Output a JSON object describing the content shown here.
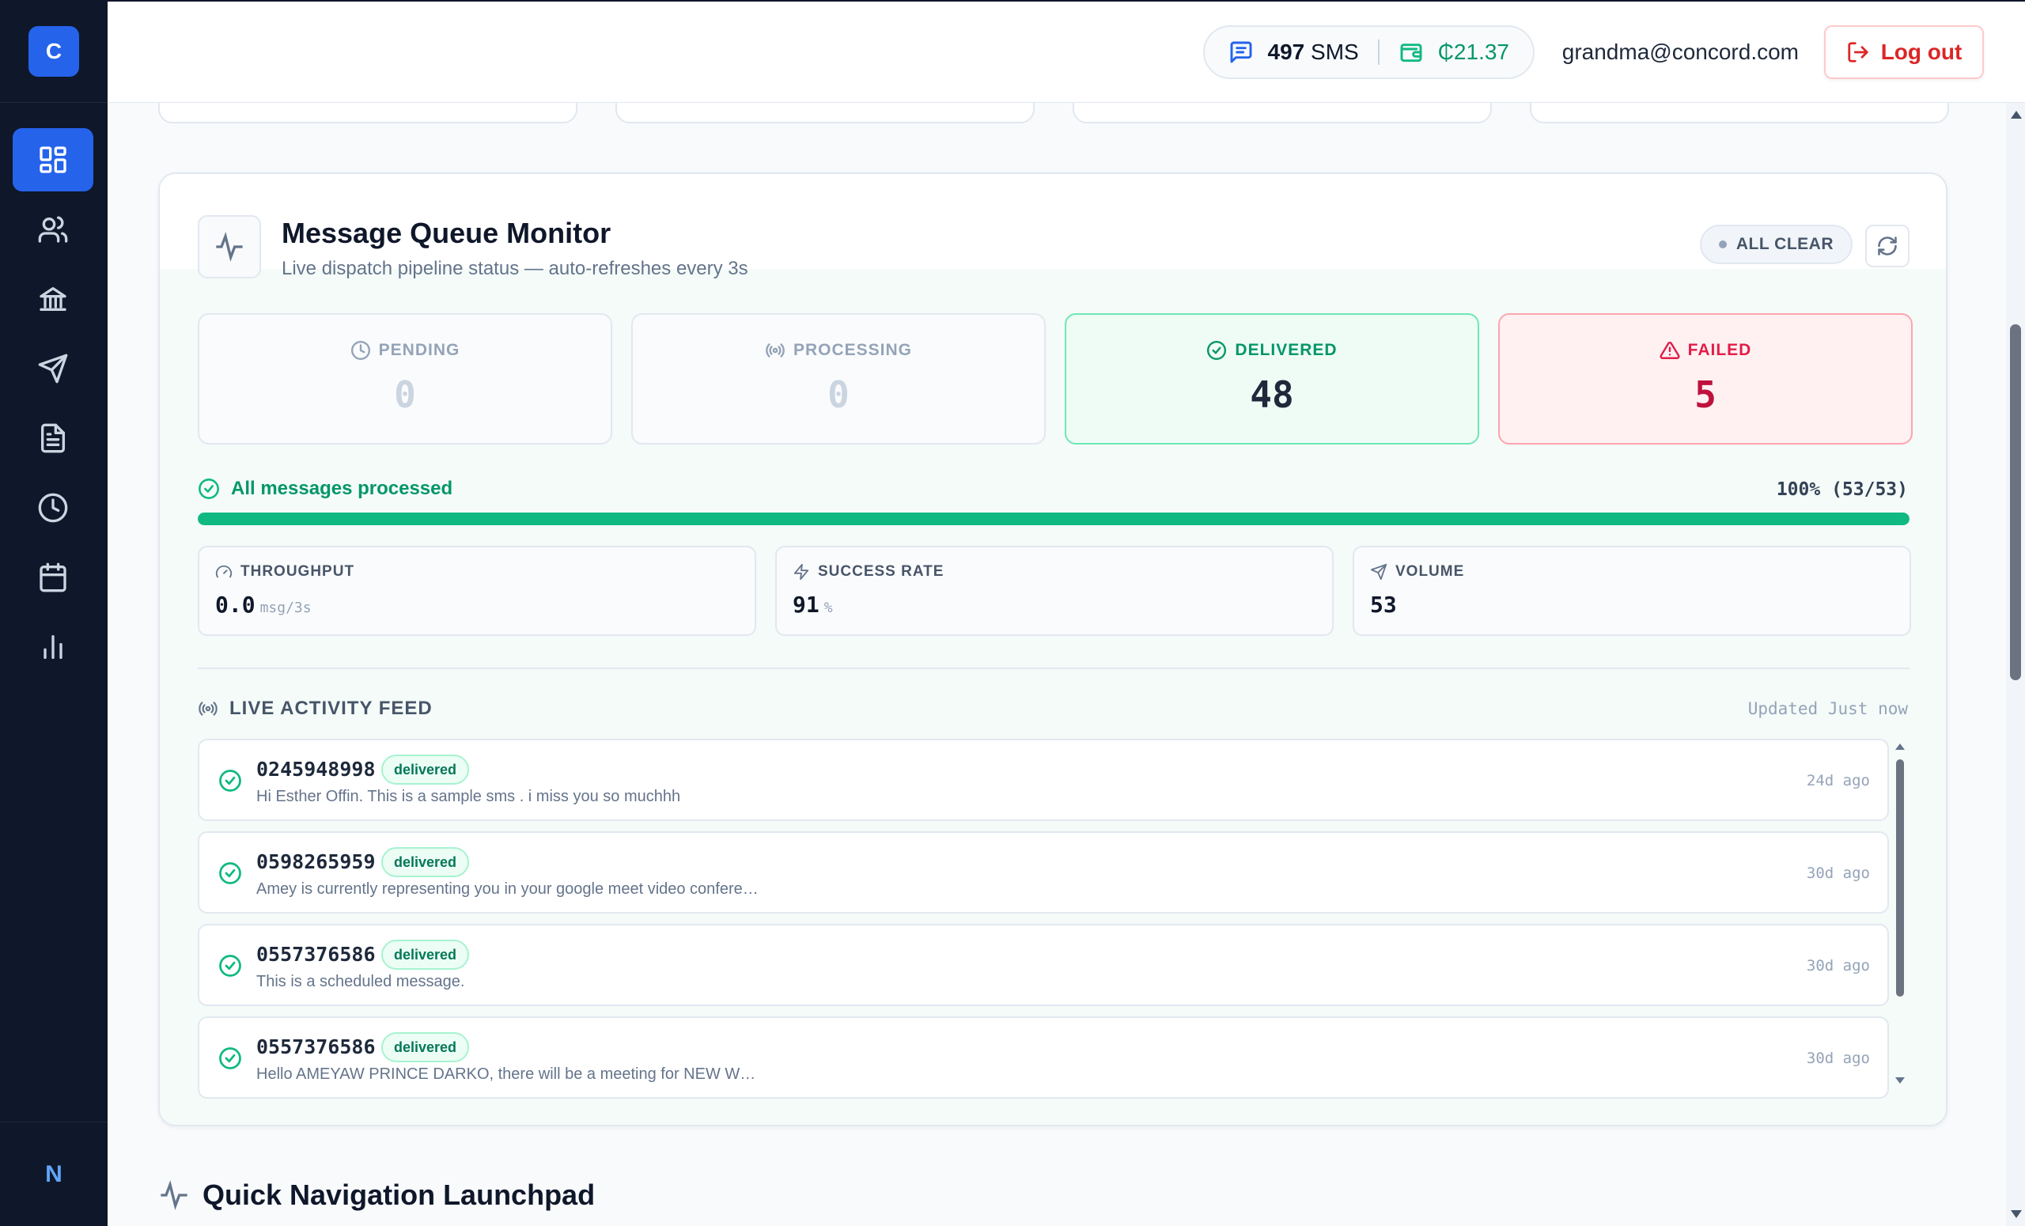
{
  "sidebar": {
    "logo_letter": "C",
    "items": [
      {
        "icon": "dashboard-icon",
        "active": true
      },
      {
        "icon": "users-icon",
        "active": false
      },
      {
        "icon": "bank-icon",
        "active": false
      },
      {
        "icon": "send-icon",
        "active": false
      },
      {
        "icon": "document-icon",
        "active": false
      },
      {
        "icon": "clock-icon",
        "active": false
      },
      {
        "icon": "calendar-icon",
        "active": false
      },
      {
        "icon": "bar-chart-icon",
        "active": false
      }
    ],
    "avatar_letter": "N"
  },
  "header": {
    "sms_count": "497",
    "sms_label": "SMS",
    "balance": "₵21.37",
    "user_email": "grandma@concord.com",
    "logout_label": "Log out"
  },
  "monitor": {
    "title": "Message Queue Monitor",
    "subtitle": "Live dispatch pipeline status — auto-refreshes every 3s",
    "status_badge": "ALL CLEAR",
    "stats": [
      {
        "label": "PENDING",
        "value": "0",
        "icon": "clock-icon"
      },
      {
        "label": "PROCESSING",
        "value": "0",
        "icon": "broadcast-icon"
      },
      {
        "label": "DELIVERED",
        "value": "48",
        "icon": "check-circle-icon"
      },
      {
        "label": "FAILED",
        "value": "5",
        "icon": "alert-triangle-icon"
      }
    ],
    "progress_label": "All messages processed",
    "progress_text": "100% (53/53)",
    "progress_fraction": 1.0,
    "metrics": [
      {
        "label": "THROUGHPUT",
        "value": "0.0",
        "unit": "msg/3s",
        "icon": "gauge-icon"
      },
      {
        "label": "SUCCESS RATE",
        "value": "91",
        "unit": "%",
        "icon": "zap-icon"
      },
      {
        "label": "VOLUME",
        "value": "53",
        "unit": "",
        "icon": "send-icon"
      }
    ],
    "feed_title": "LIVE ACTIVITY FEED",
    "feed_updated": "Updated Just now",
    "feed": [
      {
        "phone": "0245948998",
        "status": "delivered",
        "message": "Hi Esther Offin. This is a sample sms . i miss you so muchhh",
        "time": "24d ago"
      },
      {
        "phone": "0598265959",
        "status": "delivered",
        "message": "Amey is currently representing you in your google meet video confere…",
        "time": "30d ago"
      },
      {
        "phone": "0557376586",
        "status": "delivered",
        "message": "This is a scheduled message.",
        "time": "30d ago"
      },
      {
        "phone": "0557376586",
        "status": "delivered",
        "message": "Hello AMEYAW PRINCE DARKO, there will be a meeting for NEW W…",
        "time": "30d ago"
      }
    ]
  },
  "quick_nav": {
    "title": "Quick Navigation Launchpad"
  },
  "colors": {
    "accent": "#2563eb",
    "success": "#10b981",
    "danger": "#dc2626",
    "sidebar_bg": "#0f172a"
  }
}
